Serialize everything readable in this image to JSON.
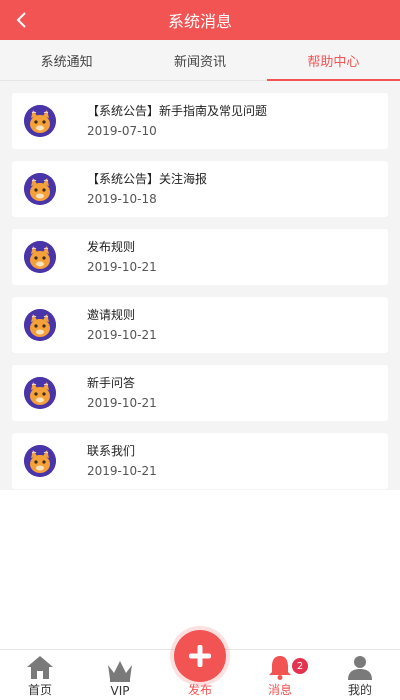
{
  "header": {
    "title": "系统消息",
    "back_icon": "chevron-left-icon"
  },
  "tabs": [
    {
      "label": "系统通知",
      "active": false
    },
    {
      "label": "新闻资讯",
      "active": false
    },
    {
      "label": "帮助中心",
      "active": true
    }
  ],
  "messages": [
    {
      "title": "【系统公告】新手指南及常见问题",
      "date": "2019-07-10"
    },
    {
      "title": "【系统公告】关注海报",
      "date": "2019-10-18"
    },
    {
      "title": "发布规则",
      "date": "2019-10-21"
    },
    {
      "title": "邀请规则",
      "date": "2019-10-21"
    },
    {
      "title": "新手问答",
      "date": "2019-10-21"
    },
    {
      "title": "联系我们",
      "date": "2019-10-21"
    }
  ],
  "tabbar": {
    "items": [
      {
        "label": "首页",
        "icon": "home-icon"
      },
      {
        "label": "VIP",
        "icon": "crown-icon"
      },
      {
        "label": "发布",
        "icon": "plus-icon"
      },
      {
        "label": "消息",
        "icon": "bell-icon",
        "badge": "2",
        "active": true
      },
      {
        "label": "我的",
        "icon": "user-icon"
      }
    ]
  },
  "colors": {
    "accent": "#f25454",
    "avatar_bg": "#4a35a8",
    "cat": "#f5a13a",
    "badge": "#e3334e"
  }
}
